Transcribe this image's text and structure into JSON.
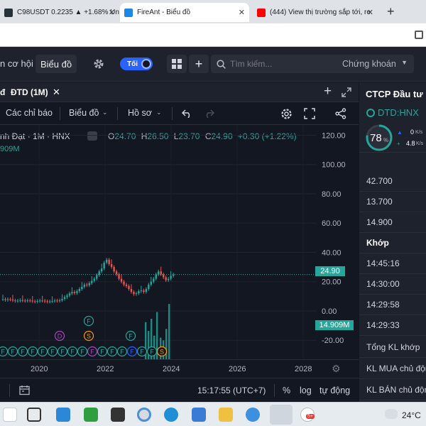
{
  "browser": {
    "tabs": [
      {
        "label": "C98USDT 0.2235 ▲ +1.68% Un",
        "icon_color": "#26323a"
      },
      {
        "label": "FireAnt - Biểu đồ",
        "icon_color": "#1e88e5"
      },
      {
        "label": "(444) View thị trường sắp tới, re",
        "icon_color": "#ff0000"
      }
    ],
    "new_tab": "+"
  },
  "nav": {
    "co_hoi": "n cơ hội",
    "bieu_do": "Biểu đồ",
    "toggle": "Tối",
    "search_placeholder": "Tìm kiếm...",
    "chung_khoan": "Chứng khoán"
  },
  "chart_tab": {
    "title": "ĐTD (1M)",
    "prefix": "đ"
  },
  "toolbar": {
    "indicators": "Các chỉ báo",
    "chart": "Biểu đồ",
    "profile": "Hồ sơ"
  },
  "legend": {
    "symbol": "nh Đạt · 1M · HNX",
    "o_label": "O",
    "o": "24.70",
    "h_label": "H",
    "h": "26.50",
    "l_label": "L",
    "l": "23.70",
    "c_label": "C",
    "c": "24.90",
    "change": "+0.30 (+1.22%)",
    "volume": "909M"
  },
  "chart_data": {
    "type": "candlestick",
    "yticks": [
      120.0,
      100.0,
      80.0,
      60.0,
      40.0,
      20.0,
      0.0,
      -20.0
    ],
    "xticks": [
      "2020",
      "2022",
      "2024",
      "2026",
      "2028"
    ],
    "last_price": "24.90",
    "volume_label": "14.909M",
    "ylim": [
      -33,
      127
    ]
  },
  "bottom": {
    "time": "15:17:55 (UTC+7)",
    "percent": "%",
    "log": "log",
    "auto": "tự động"
  },
  "right_panel": {
    "company": "CTCP Đầu tư",
    "ticker": "DTD:HNX",
    "gauge": "78",
    "gauge_unit": "%",
    "up": "0",
    "up_unit": "K/s",
    "down": "4.8",
    "down_unit": "K/s",
    "prices": [
      "42.700",
      "13.700",
      "14.900"
    ],
    "khop_header": "Khớp",
    "times": [
      "14:45:16",
      "14:30:00",
      "14:29:58",
      "14:29:33"
    ],
    "tong_kl": "Tổng KL khớp",
    "kl_mua": "KL MUA chủ độn",
    "kl_ban": "KL BÁN chủ độn"
  },
  "taskbar": {
    "weather": "24°C",
    "badge": "5+"
  }
}
